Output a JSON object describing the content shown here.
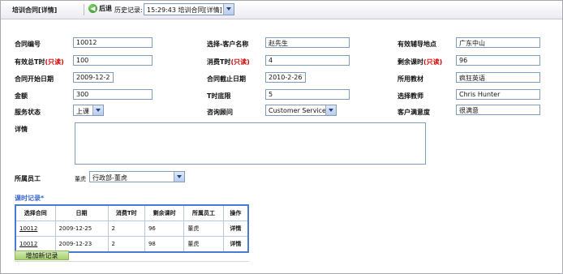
{
  "header": {
    "title": "培训合同[详情]",
    "back_label": "后退",
    "history_label": "历史记录:",
    "history_selected": "15:29:43 培训合同[详情]"
  },
  "form": {
    "contract_no": {
      "label": "合同编号",
      "value": "10012"
    },
    "customer": {
      "label": "选择-客户名称",
      "value": "赵先生"
    },
    "tutoring_location": {
      "label": "有效辅导地点",
      "value": "广东中山"
    },
    "total_hours": {
      "label": "有效总T时",
      "readonly": "(只读)",
      "value": "100"
    },
    "consumed_hours": {
      "label": "消费T时",
      "readonly": "(只读)",
      "value": "4"
    },
    "remaining_hours": {
      "label": "剩余课时",
      "readonly": "(只读)",
      "value": "96"
    },
    "start_date": {
      "label": "合同开始日期",
      "value": "2009-12-2"
    },
    "end_date": {
      "label": "合同截止日期",
      "value": "2010-2-26"
    },
    "textbook": {
      "label": "所用教材",
      "value": "疯狂英语"
    },
    "amount": {
      "label": "金额",
      "value": "300"
    },
    "t_minimum": {
      "label": "T时底限",
      "value": "5"
    },
    "teacher": {
      "label": "选择教师",
      "value": "Chris Hunter"
    },
    "service_status": {
      "label": "服务状态",
      "value": "上课"
    },
    "consultant": {
      "label": "咨询顾问",
      "value": "Customer Service"
    },
    "satisfaction": {
      "label": "客户满意度",
      "value": "很满意"
    },
    "details": {
      "label": "详情",
      "value": ""
    },
    "staff": {
      "label": "所属员工",
      "name": "董虎",
      "dept": "行政部-董虎"
    }
  },
  "records": {
    "title": "课时记录*",
    "columns": [
      "选择合同",
      "日期",
      "消费T时",
      "剩余课时",
      "所属员工",
      "操作"
    ],
    "rows": [
      {
        "contract": "10012",
        "date": "2009-12-25",
        "consumed": "2",
        "remaining": "96",
        "staff": "董虎",
        "op": "详情"
      },
      {
        "contract": "10012",
        "date": "2009-12-23",
        "consumed": "2",
        "remaining": "98",
        "staff": "董虎",
        "op": "详情"
      }
    ],
    "add_label": "增加新记录"
  }
}
